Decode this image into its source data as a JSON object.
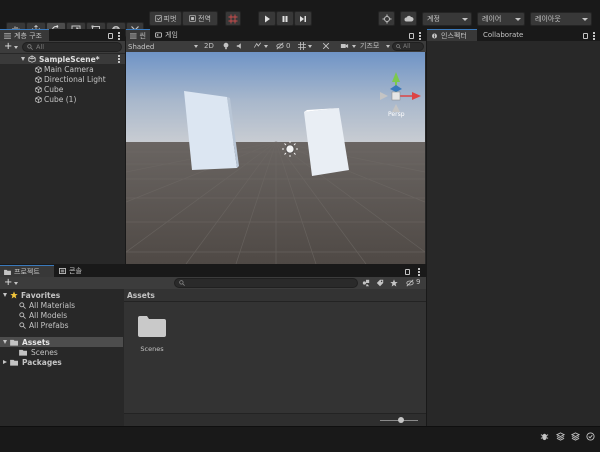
{
  "toolbar": {
    "pivot_label": "피벗",
    "global_label": "전역",
    "account_label": "계정",
    "layers_label": "레이어",
    "layout_label": "레이아웃"
  },
  "hierarchy": {
    "tab_label": "계층 구조",
    "search_placeholder": "All",
    "scene_name": "SampleScene*",
    "objects": [
      "Main Camera",
      "Directional Light",
      "Cube",
      "Cube (1)"
    ]
  },
  "scene": {
    "tab_scene": "씬",
    "tab_game": "게임",
    "shading_mode": "Shaded",
    "mode_2d": "2D",
    "layer_count": "0",
    "gizmos_label": "기즈모",
    "search_placeholder": "All",
    "persp_label": "Persp"
  },
  "project": {
    "tab_project": "프로젝트",
    "tab_console": "콘솔",
    "hidden_count": "9",
    "favorites_label": "Favorites",
    "favorites": [
      "All Materials",
      "All Models",
      "All Prefabs"
    ],
    "assets_label": "Assets",
    "assets_children": [
      "Scenes"
    ],
    "packages_label": "Packages",
    "breadcrumb": "Assets",
    "folder_items": [
      "Scenes"
    ]
  },
  "inspector": {
    "tab_label": "인스펙터",
    "collab_label": "Collaborate"
  },
  "colors": {
    "accent": "#3a79bb",
    "selection": "#4d4d4d",
    "sky_top": "#6e93c4",
    "sky_bottom": "#c5cbd3",
    "ground": "#504a45"
  }
}
